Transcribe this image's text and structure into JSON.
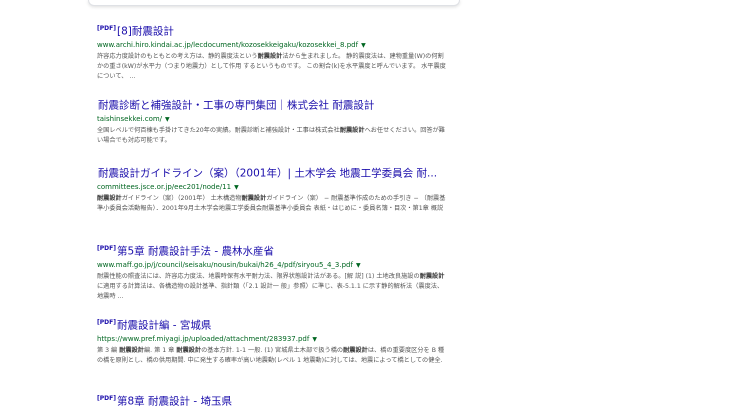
{
  "results": [
    {
      "pdf": "[PDF]",
      "title": "[8]耐震設計",
      "url": "www.archi.hiro.kindai.ac.jp/lecdocument/kozosekkeigaku/kozosekkei_8.pdf",
      "snippet": [
        {
          "t": "許容応力度設計のもともとの考え方は、静的震度法という"
        },
        {
          "t": "耐震設計",
          "b": true
        },
        {
          "t": "法から生まれました。 静的震度法は、建物重量(W)の何割かの重さ(kW)が水平力（つまり地震力）として作用 するというものです。 この割合(k)を水平震度と呼んでいます。 水平震度について、 ..."
        }
      ]
    },
    {
      "pdf": "",
      "title": "耐震診断と補強設計・工事の専門集団｜株式会社 耐震設計",
      "url": "taishinsekkei.com/",
      "snippet": [
        {
          "t": "全国レベルで何百棟も手掛けてきた20年の実績。耐震診断と補強設計・工事は株式会社"
        },
        {
          "t": "耐震設計",
          "b": true
        },
        {
          "t": "へお任せください。回答が難い場合でも対応可能です。"
        }
      ]
    },
    {
      "pdf": "",
      "title": "耐震設計ガイドライン（案）（2001年）| 土木学会 地震工学委員会 耐...",
      "url": "committees.jsce.or.jp/eec201/node/11",
      "snippet": [
        {
          "t": "耐震設計",
          "b": true
        },
        {
          "t": "ガイドライン（案）（2001年） 土木構造物"
        },
        {
          "t": "耐震設計",
          "b": true
        },
        {
          "t": "ガイドライン（案） − 耐震基準作成のための手引き − （耐震基準小委員会活動報告）．2001年9月土木学会地震工学委員会耐震基準小委員会 表紙・はじめに・委員名簿・目次・第1章 概説"
        }
      ]
    },
    {
      "pdf": "[PDF]",
      "title": "第5章 耐震設計手法 - 農林水産省",
      "url": "www.maff.go.jp/j/council/seisaku/nousin/bukai/h26_4/pdf/siryou5_4_3.pdf",
      "snippet": [
        {
          "t": "耐震性能の照査法には、許容応力度法、地震時保有水平耐力法、限界状態設計法がある。[解 説] (1) 土地改良施設の"
        },
        {
          "t": "耐震設計",
          "b": true
        },
        {
          "t": "に適用する計算法は、各構造物の設計基準、指針類（「2.1 設計一 般」参照）に準じ、表-5.1.1 に示す静的解析法（震度法、地震時 ..."
        }
      ]
    },
    {
      "pdf": "[PDF]",
      "title": "耐震設計編 - 宮城県",
      "url": "https://www.pref.miyagi.jp/uploaded/attachment/283937.pdf",
      "snippet": [
        {
          "t": "第 3 編 "
        },
        {
          "t": "耐震設計",
          "b": true
        },
        {
          "t": "編. 第 1 章 "
        },
        {
          "t": "耐震設計",
          "b": true
        },
        {
          "t": "の基本方針. 1-1 一般. (1) 宮城県土木部で扱う橋の"
        },
        {
          "t": "耐震設計",
          "b": true
        },
        {
          "t": "は、橋の重要度区分を B 種の橋を原則とし、橋の供用期間. 中に発生する確率が高い地震動(レベル 1 地震動)に対しては、地震によって橋としての健全."
        }
      ]
    },
    {
      "pdf": "[PDF]",
      "title": "第8章 耐震設計 - 埼玉県",
      "url": "",
      "snippet": []
    }
  ]
}
